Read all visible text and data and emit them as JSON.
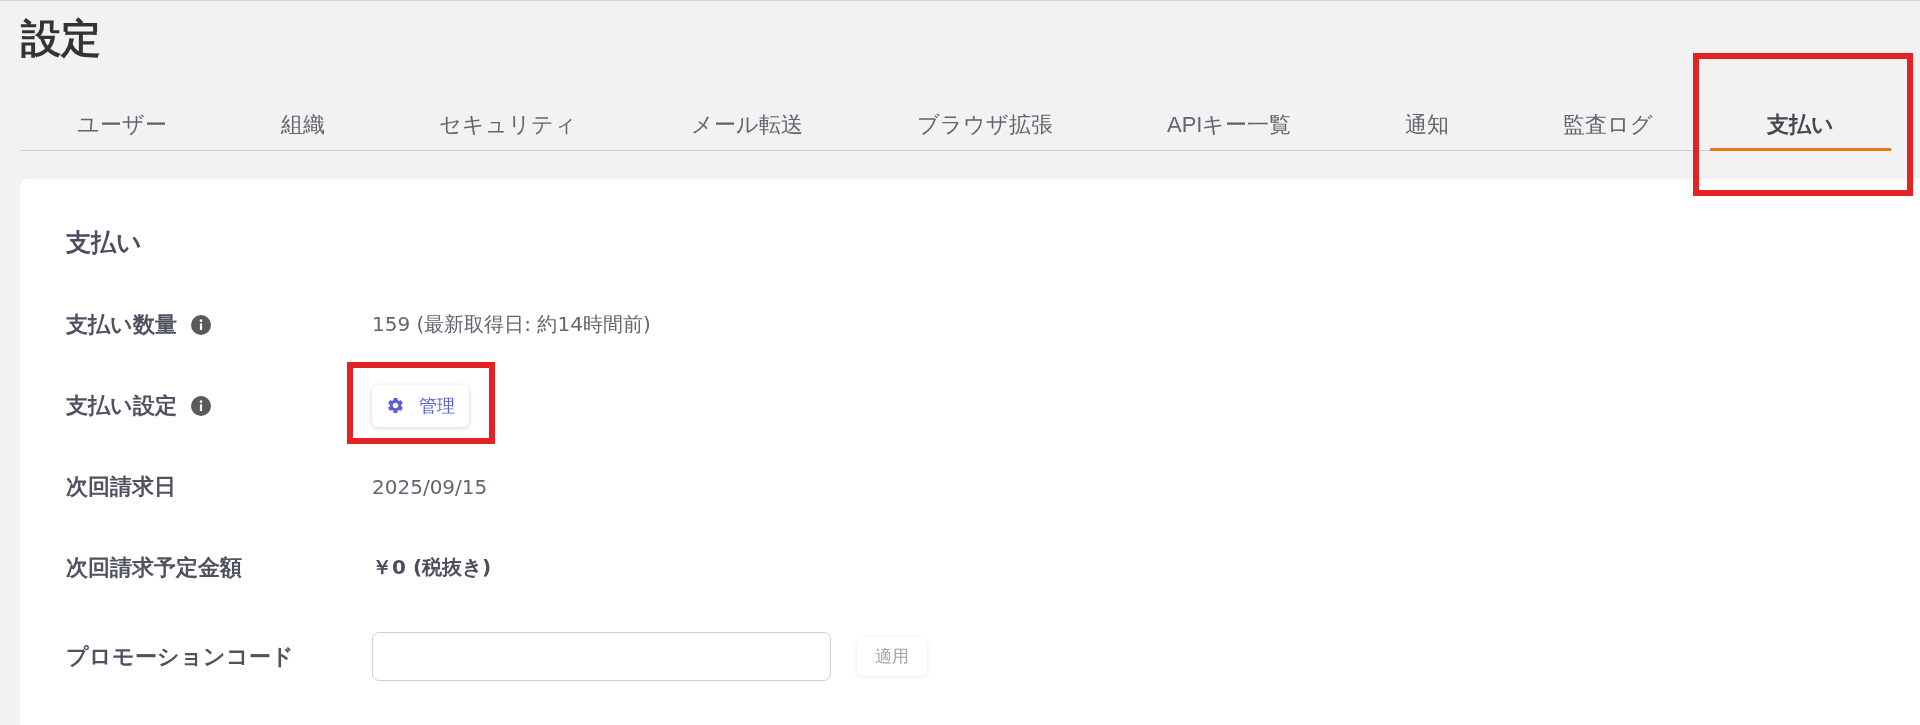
{
  "page_title": "設定",
  "tabs": [
    {
      "label": "ユーザー",
      "selected": false,
      "highlighted": false
    },
    {
      "label": "組織",
      "selected": false,
      "highlighted": false
    },
    {
      "label": "セキュリティ",
      "selected": false,
      "highlighted": false
    },
    {
      "label": "メール転送",
      "selected": false,
      "highlighted": false
    },
    {
      "label": "ブラウザ拡張",
      "selected": false,
      "highlighted": false
    },
    {
      "label": "APIキー一覧",
      "selected": false,
      "highlighted": false
    },
    {
      "label": "通知",
      "selected": false,
      "highlighted": false
    },
    {
      "label": "監査ログ",
      "selected": false,
      "highlighted": false
    },
    {
      "label": "支払い",
      "selected": true,
      "highlighted": true
    }
  ],
  "section": {
    "title": "支払い",
    "rows": [
      {
        "kind": "text",
        "label": "支払い数量",
        "info": true,
        "value": "159 (最新取得日: 約14時間前)"
      },
      {
        "kind": "button",
        "label": "支払い設定",
        "info": true,
        "button": {
          "label": "管理",
          "highlighted": true
        }
      },
      {
        "kind": "text",
        "label": "次回請求日",
        "info": false,
        "value": "2025/09/15"
      },
      {
        "kind": "bold",
        "label": "次回請求予定金額",
        "info": false,
        "value": "￥0 (税抜き)"
      },
      {
        "kind": "input",
        "label": "プロモーションコード",
        "info": false,
        "button": {
          "label": "適用",
          "disabled": true
        }
      }
    ]
  }
}
